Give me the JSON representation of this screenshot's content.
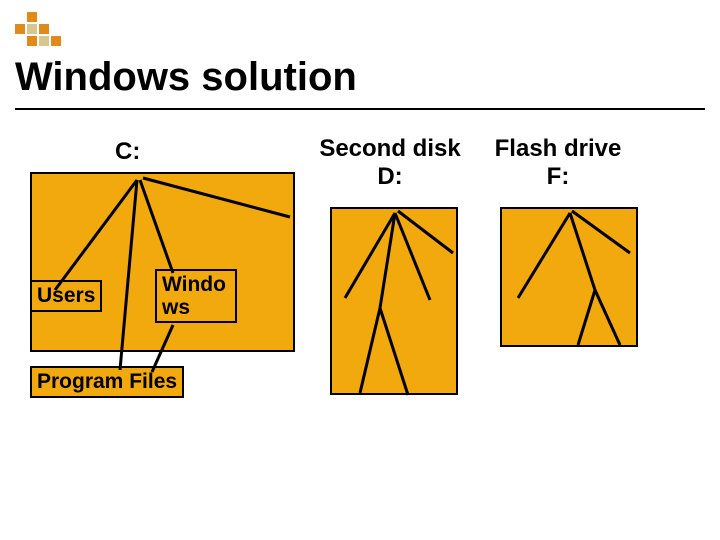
{
  "title": "Windows solution",
  "drives": {
    "c": {
      "label": "C:"
    },
    "d": {
      "label_line1": "Second disk",
      "label_line2": "D:"
    },
    "f": {
      "label_line1": "Flash drive",
      "label_line2": "F:"
    }
  },
  "folders": {
    "users": "Users",
    "windows_line1": "Windo",
    "windows_line2": "ws",
    "progfiles": "Program Files"
  },
  "colors": {
    "box_fill": "#f1a90e",
    "icon_orange": "#e08a1a",
    "icon_beige": "#d9c68f"
  }
}
